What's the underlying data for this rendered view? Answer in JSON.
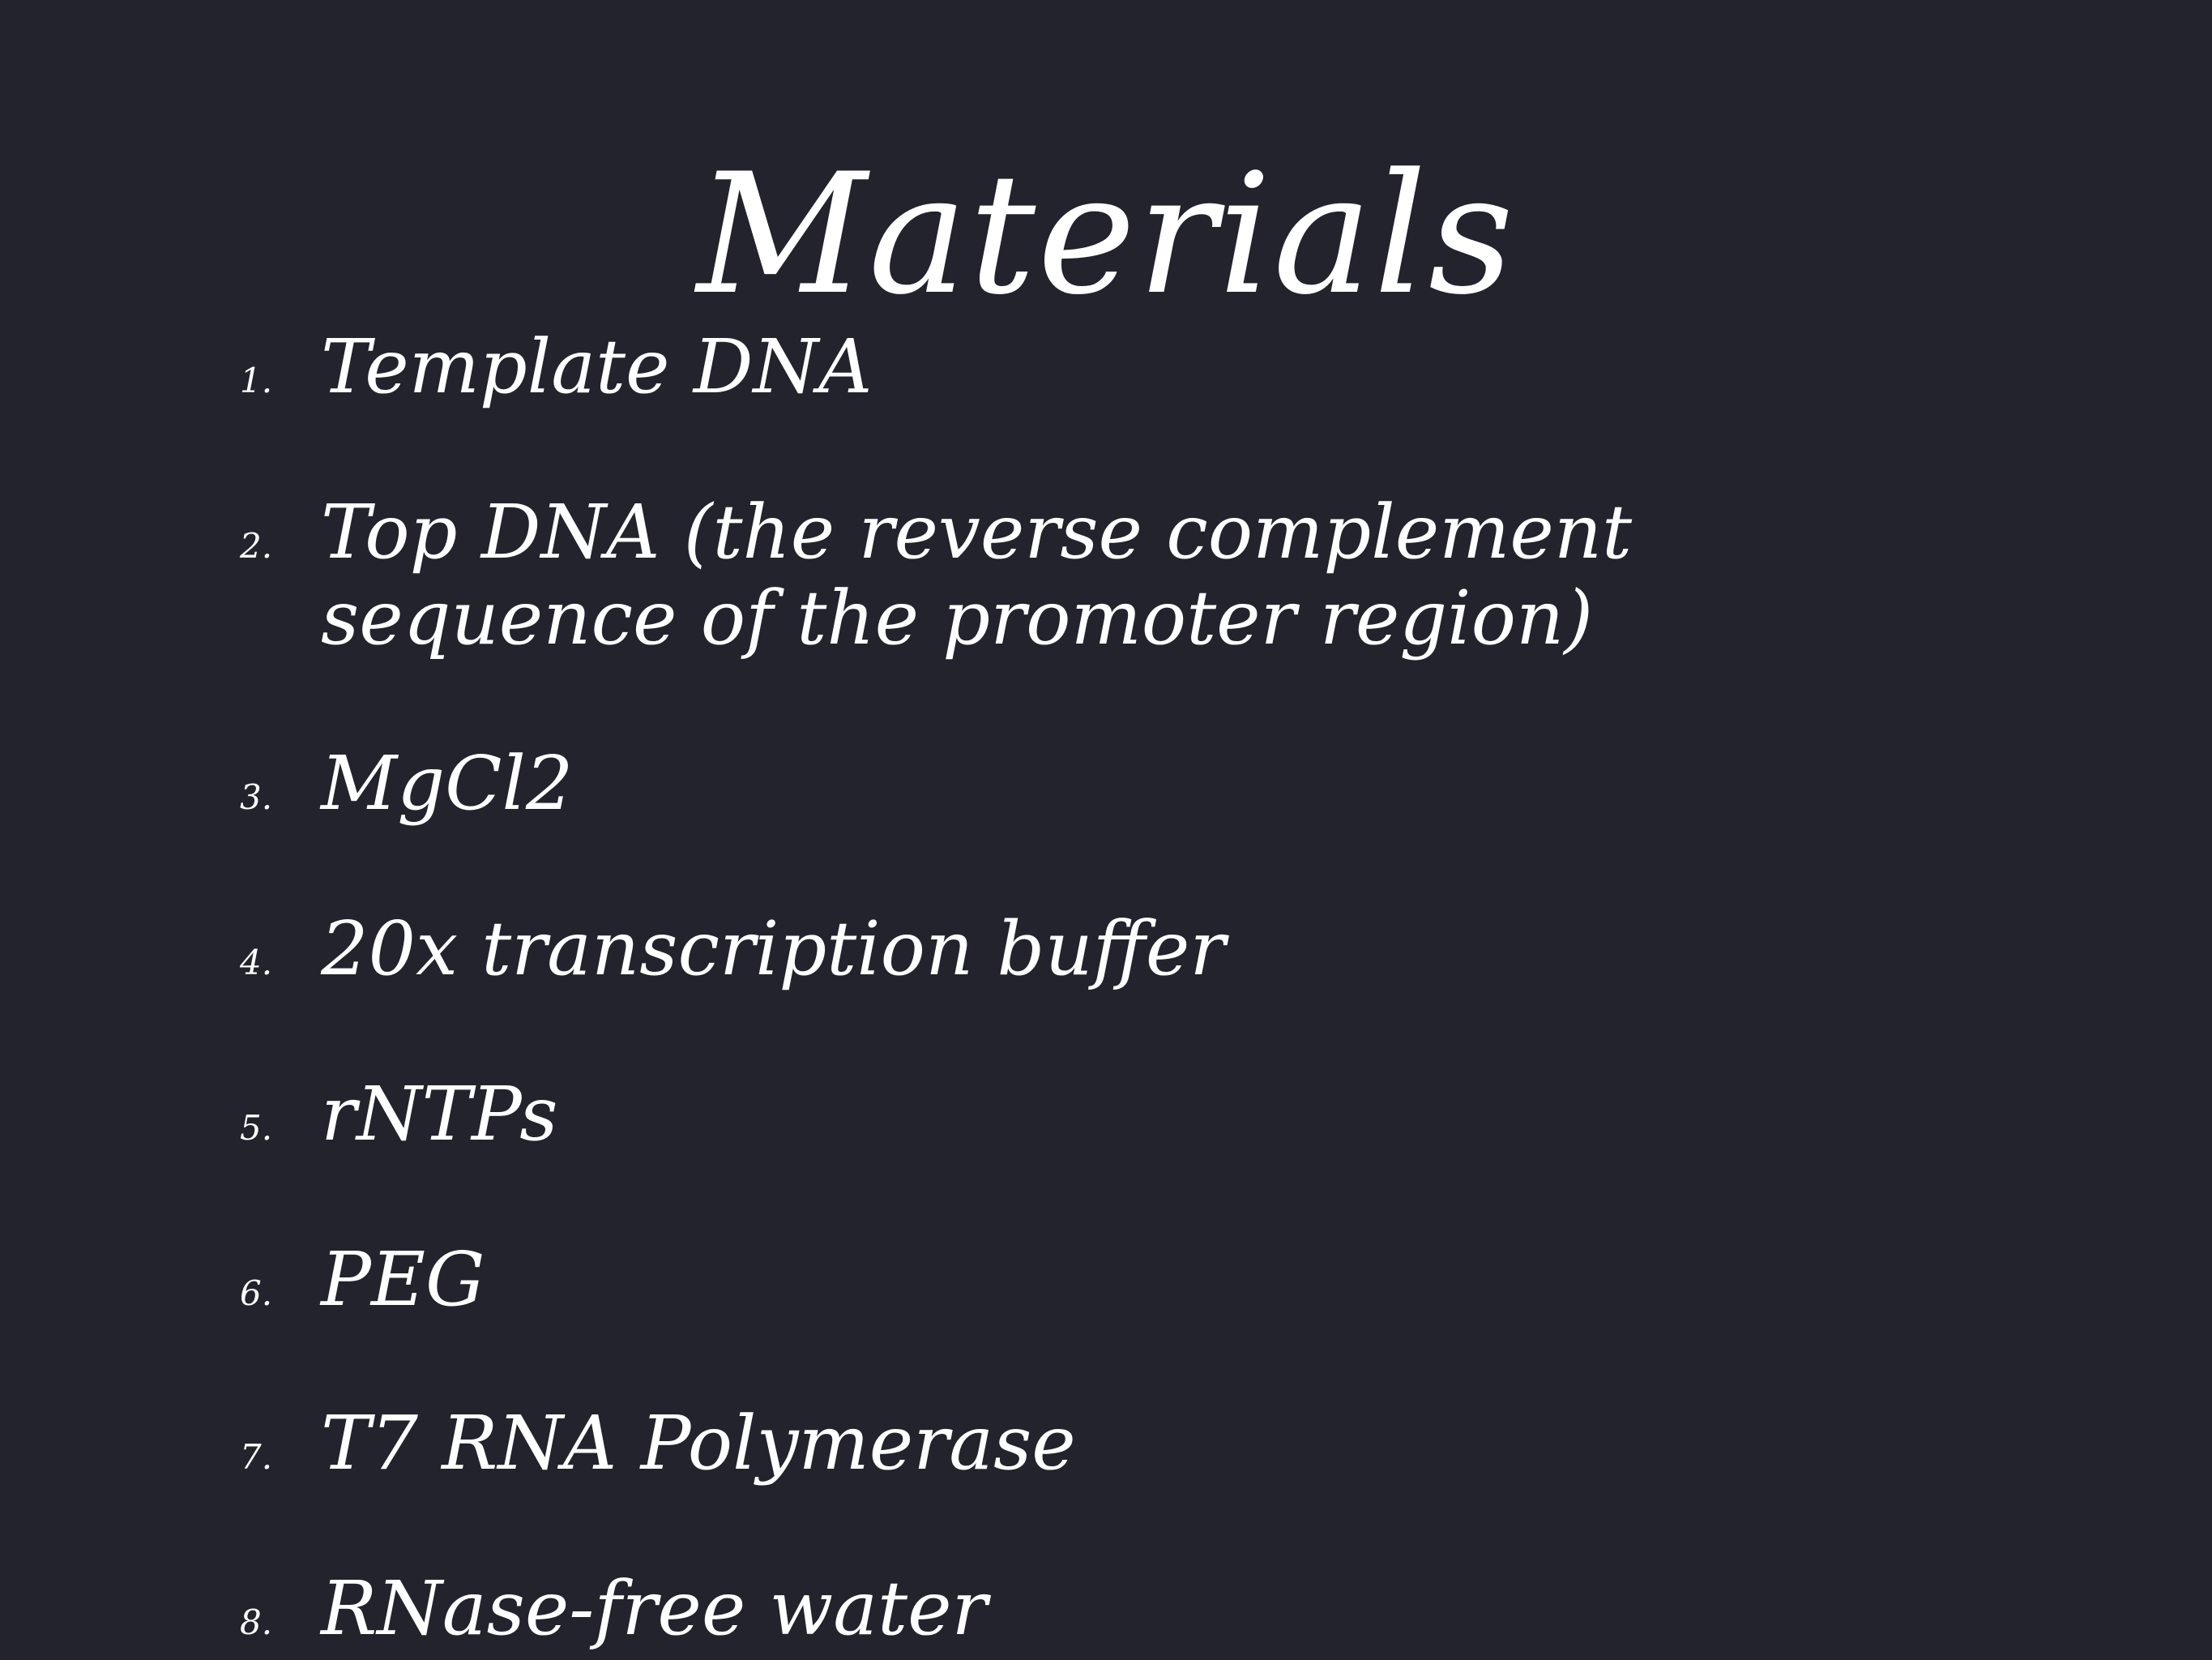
{
  "slide": {
    "title": "Materials",
    "items": [
      {
        "number": "1.",
        "lines": [
          "Template DNA"
        ]
      },
      {
        "number": "2.",
        "lines": [
          "Top DNA (the reverse complement",
          "sequence of the promoter region)"
        ]
      },
      {
        "number": "3.",
        "lines": [
          "MgCl2"
        ]
      },
      {
        "number": "4.",
        "lines": [
          "20x transcription buffer"
        ]
      },
      {
        "number": "5.",
        "lines": [
          "rNTPs"
        ]
      },
      {
        "number": "6.",
        "lines": [
          "PEG"
        ]
      },
      {
        "number": "7.",
        "lines": [
          "T7 RNA Polymerase"
        ]
      },
      {
        "number": "8.",
        "lines": [
          "RNase-free water"
        ]
      }
    ]
  },
  "colors": {
    "background": "#23232d",
    "text": "#ffffff"
  }
}
